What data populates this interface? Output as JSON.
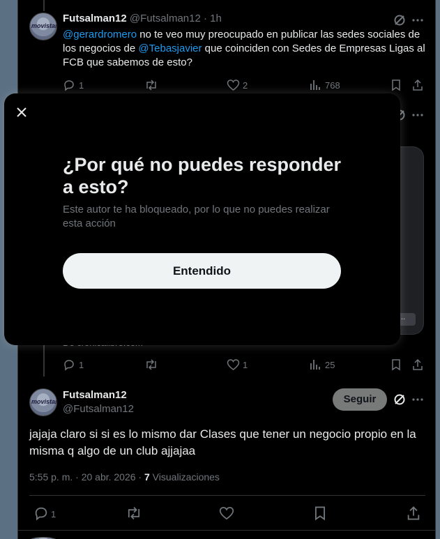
{
  "tweet1": {
    "display_name": "Futsalman12",
    "handle": "@Futsalman12",
    "time": "· 1h",
    "avatar_text": "movistar",
    "mention1": "@gerardromero",
    "text_a": " no te veo muy preocupado en publicar las sedes sociales de los negocios de ",
    "mention2": "@Tebasjavier",
    "text_b": " que coinciden con Sedes de Empresas Ligas al FCB que sabemos de esto?",
    "replies": "1",
    "likes": "2",
    "views": "768"
  },
  "tweet2": {
    "source": "De cronicalibre.com",
    "replies": "1",
    "likes": "1",
    "views": "25"
  },
  "main_tweet": {
    "display_name": "Futsalman12",
    "handle": "@Futsalman12",
    "avatar_text": "movistar",
    "follow_label": "Seguir",
    "text": "jajaja claro si si es lo mismo dar Clases que tener un negocio propio en la misma q algo de un club ajjajaa",
    "timestamp": "5:55 p. m. · 20 abr. 2026 · ",
    "views_count": "7",
    "views_label": " Visualizaciones",
    "replies": "1"
  },
  "modal": {
    "title": "¿Por qué no puedes responder a esto?",
    "body": "Este autor te ha bloqueado, por lo que no puedes realizar esta acción",
    "button": "Entendido"
  },
  "card_pill": "..."
}
